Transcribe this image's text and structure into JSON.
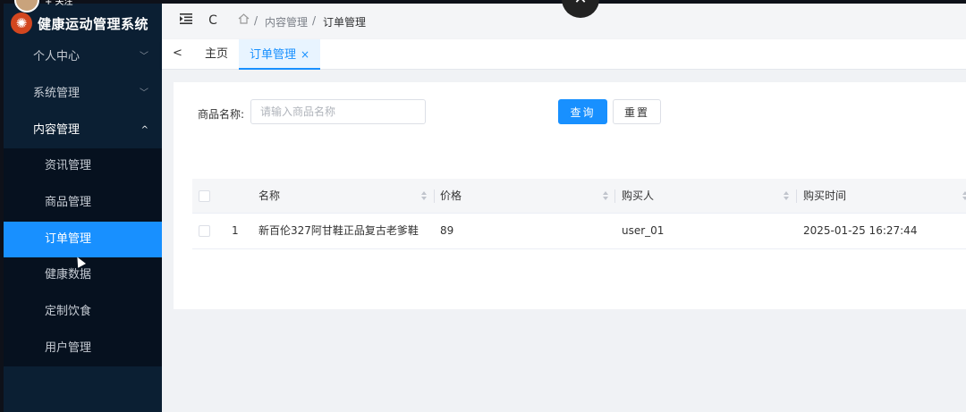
{
  "brand": {
    "title": "健康运动管理系统",
    "follow": "+ 关注"
  },
  "sidebar": {
    "menus": [
      {
        "label": "个人中心",
        "chevron": "﹀"
      },
      {
        "label": "系统管理",
        "chevron": "﹀"
      },
      {
        "label": "内容管理",
        "chevron": "^"
      }
    ],
    "sub_items": [
      {
        "label": "资讯管理"
      },
      {
        "label": "商品管理"
      },
      {
        "label": "订单管理"
      },
      {
        "label": "健康数据"
      },
      {
        "label": "定制饮食"
      },
      {
        "label": "用户管理"
      }
    ]
  },
  "header": {
    "breadcrumb": [
      "内容管理",
      "订单管理"
    ],
    "sep": "/"
  },
  "tags": {
    "home": "主页",
    "active": "订单管理"
  },
  "search": {
    "label": "商品名称:",
    "placeholder": "请输入商品名称",
    "query_button": "查询",
    "reset_button": "重置"
  },
  "table": {
    "columns": [
      "名称",
      "价格",
      "购买人",
      "购买时间"
    ],
    "rows": [
      {
        "index": "1",
        "name": "新百伦327阿甘鞋正品复古老爹鞋",
        "price": "89",
        "buyer": "user_01",
        "time": "2025-01-25 16:27:44"
      }
    ]
  },
  "colors": {
    "sidebar": "#0b1f33",
    "accent": "#1890ff"
  },
  "icons": [
    "menu-fold-icon",
    "refresh-icon",
    "home-icon",
    "close-icon",
    "chevron-left-icon",
    "sort-icon",
    "checkbox-icon"
  ]
}
